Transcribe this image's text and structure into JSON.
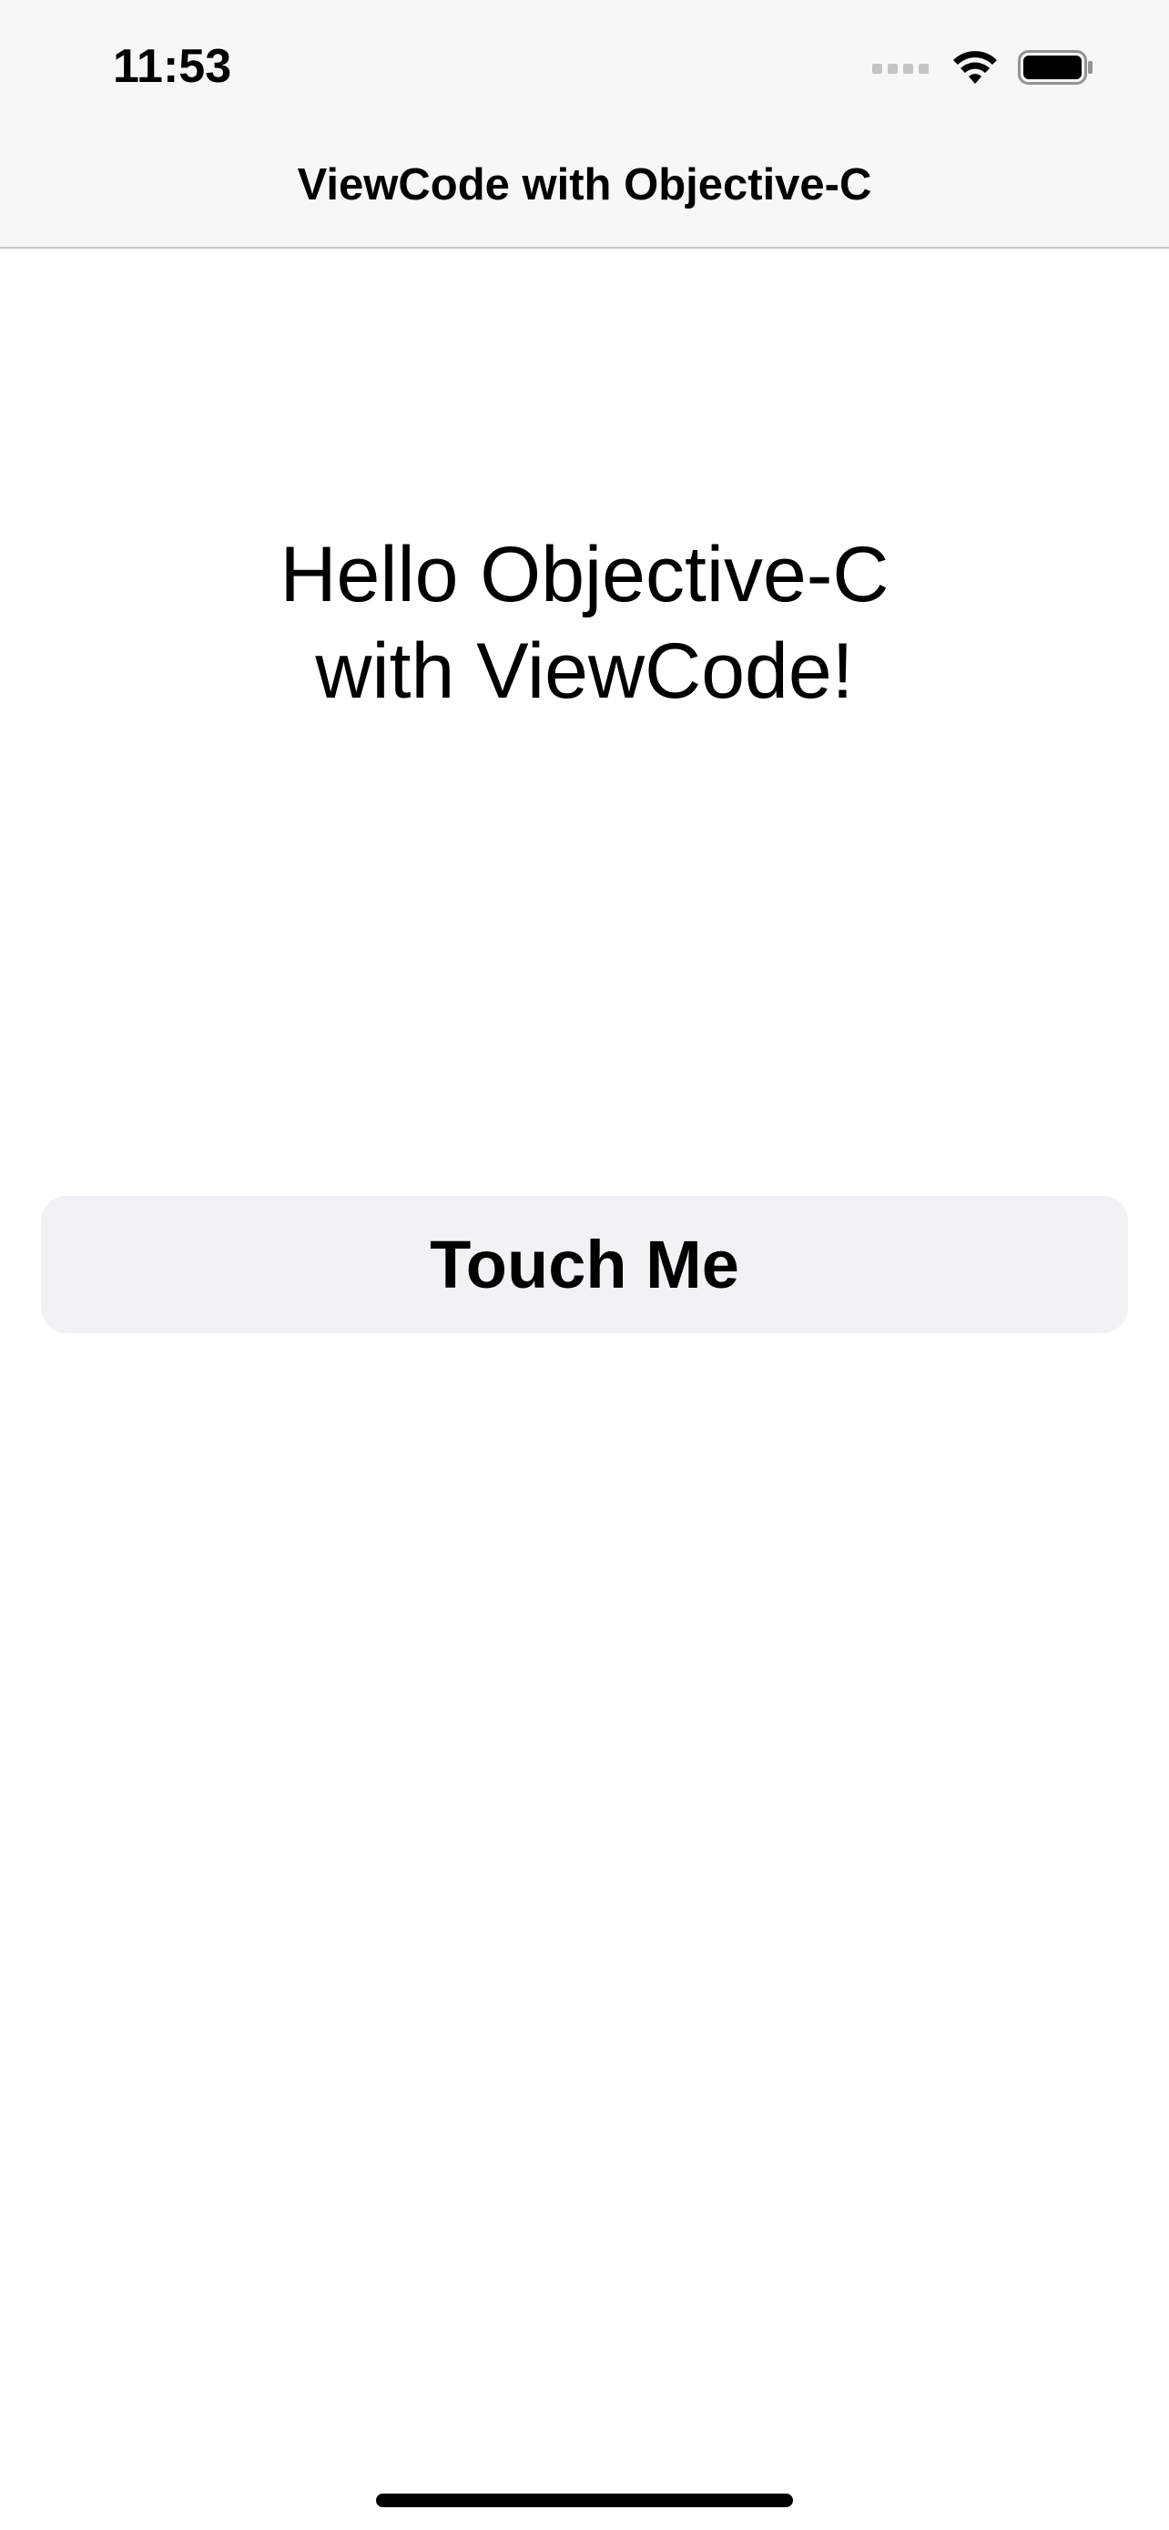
{
  "status_bar": {
    "time": "11:53",
    "icons": [
      "signal-icon",
      "wifi-icon",
      "battery-icon"
    ]
  },
  "nav_bar": {
    "title": "ViewCode with Objective-C"
  },
  "main": {
    "label_text": "Hello Objective-C\nwith ViewCode!",
    "button_label": "Touch Me"
  },
  "colors": {
    "nav_background": "#f7f7f7",
    "button_background": "#f2f2f6",
    "text": "#000000",
    "separator": "#c9c9cb"
  }
}
